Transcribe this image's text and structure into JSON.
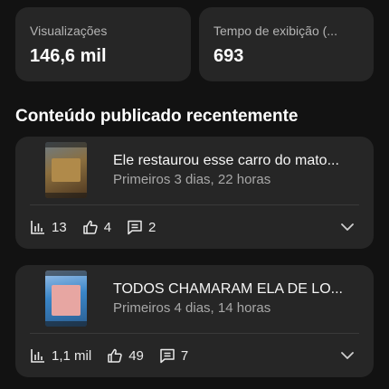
{
  "stats": {
    "views_label": "Visualizações",
    "views_value": "146,6 mil",
    "watch_label": "Tempo de exibição (...",
    "watch_value": "693"
  },
  "section": {
    "title": "Conteúdo publicado recentemente"
  },
  "videos": [
    {
      "title": "Ele restaurou esse carro do mato...",
      "subtitle": "Primeiros 3 dias, 22 horas",
      "views": "13",
      "likes": "4",
      "comments": "2"
    },
    {
      "title": "TODOS CHAMARAM ELA DE LO...",
      "subtitle": "Primeiros 4 dias, 14 horas",
      "views": "1,1 mil",
      "likes": "49",
      "comments": "7"
    }
  ],
  "icons": {
    "views": "bar-chart-icon",
    "likes": "thumbs-up-icon",
    "comments": "comment-icon",
    "expand": "chevron-down-icon"
  },
  "colors": {
    "background": "#121212",
    "card": "#262626",
    "text_primary": "#ffffff",
    "text_secondary": "#a8a8a8"
  }
}
